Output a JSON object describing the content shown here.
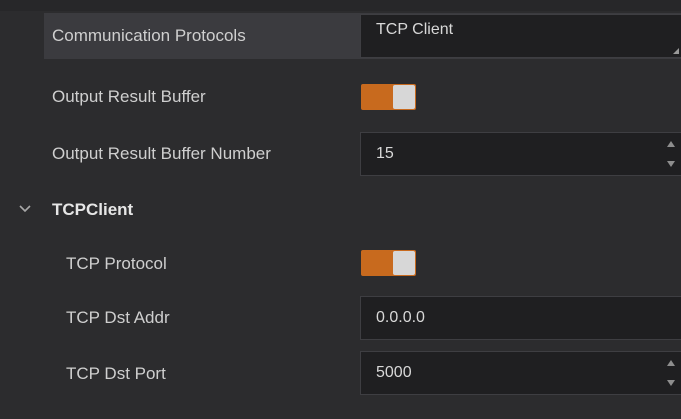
{
  "settings": {
    "communication_protocols": {
      "label": "Communication Protocols",
      "value": "TCP Client"
    },
    "output_result_buffer": {
      "label": "Output Result Buffer",
      "enabled": true
    },
    "output_result_buffer_number": {
      "label": "Output Result Buffer Number",
      "value": "15"
    }
  },
  "tcp_client_section": {
    "title": "TCPClient",
    "expanded": true,
    "tcp_protocol": {
      "label": "TCP Protocol",
      "enabled": true
    },
    "tcp_dst_addr": {
      "label": "TCP Dst Addr",
      "value": "0.0.0.0"
    },
    "tcp_dst_port": {
      "label": "TCP Dst Port",
      "value": "5000"
    }
  },
  "colors": {
    "background": "#2c2c2e",
    "toggle_on": "#c86a1e",
    "field_bg": "#1f1f21",
    "text": "#cfcfcf"
  },
  "icons": {
    "section_toggle": "chevron-down-icon",
    "combo_arrow": "dropdown-corner-icon",
    "spin_up": "arrow-up-icon",
    "spin_down": "arrow-down-icon"
  }
}
